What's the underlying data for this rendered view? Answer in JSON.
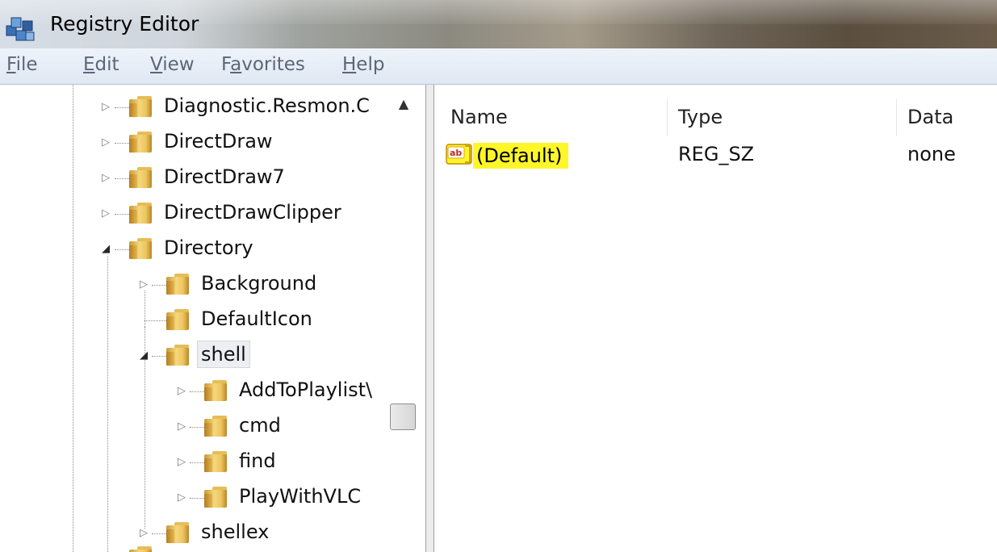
{
  "window": {
    "title": "Registry Editor",
    "icon": "registry-editor-icon"
  },
  "menu": [
    {
      "label": "File",
      "mnemonic": "F",
      "rest": "ile"
    },
    {
      "label": "Edit",
      "mnemonic": "E",
      "rest": "dit"
    },
    {
      "label": "View",
      "mnemonic": "V",
      "rest": "iew"
    },
    {
      "label": "Favorites",
      "pre": "F",
      "mnemonic": "a",
      "rest": "vorites"
    },
    {
      "label": "Help",
      "mnemonic": "H",
      "rest": "elp"
    }
  ],
  "tree": {
    "nodes": [
      {
        "label": "Diagnostic.Resmon.C",
        "expander": "collapsed"
      },
      {
        "label": "DirectDraw",
        "expander": "collapsed"
      },
      {
        "label": "DirectDraw7",
        "expander": "collapsed"
      },
      {
        "label": "DirectDrawClipper",
        "expander": "collapsed"
      },
      {
        "label": "Directory",
        "expander": "expanded"
      },
      {
        "label": "Background",
        "expander": "collapsed"
      },
      {
        "label": "DefaultIcon",
        "expander": "none"
      },
      {
        "label": "shell",
        "expander": "expanded",
        "selected": true
      },
      {
        "label": "AddToPlaylist\\",
        "expander": "collapsed"
      },
      {
        "label": "cmd",
        "expander": "collapsed"
      },
      {
        "label": "find",
        "expander": "collapsed"
      },
      {
        "label": "PlayWithVLC",
        "expander": "collapsed"
      },
      {
        "label": "shellex",
        "expander": "collapsed"
      }
    ]
  },
  "values": {
    "columns": [
      "Name",
      "Type",
      "Data"
    ],
    "rows": [
      {
        "name": "(Default)",
        "type": "REG_SZ",
        "data": "none",
        "icon": "string-value-ab-icon",
        "highlight": "#fff62a"
      }
    ]
  }
}
